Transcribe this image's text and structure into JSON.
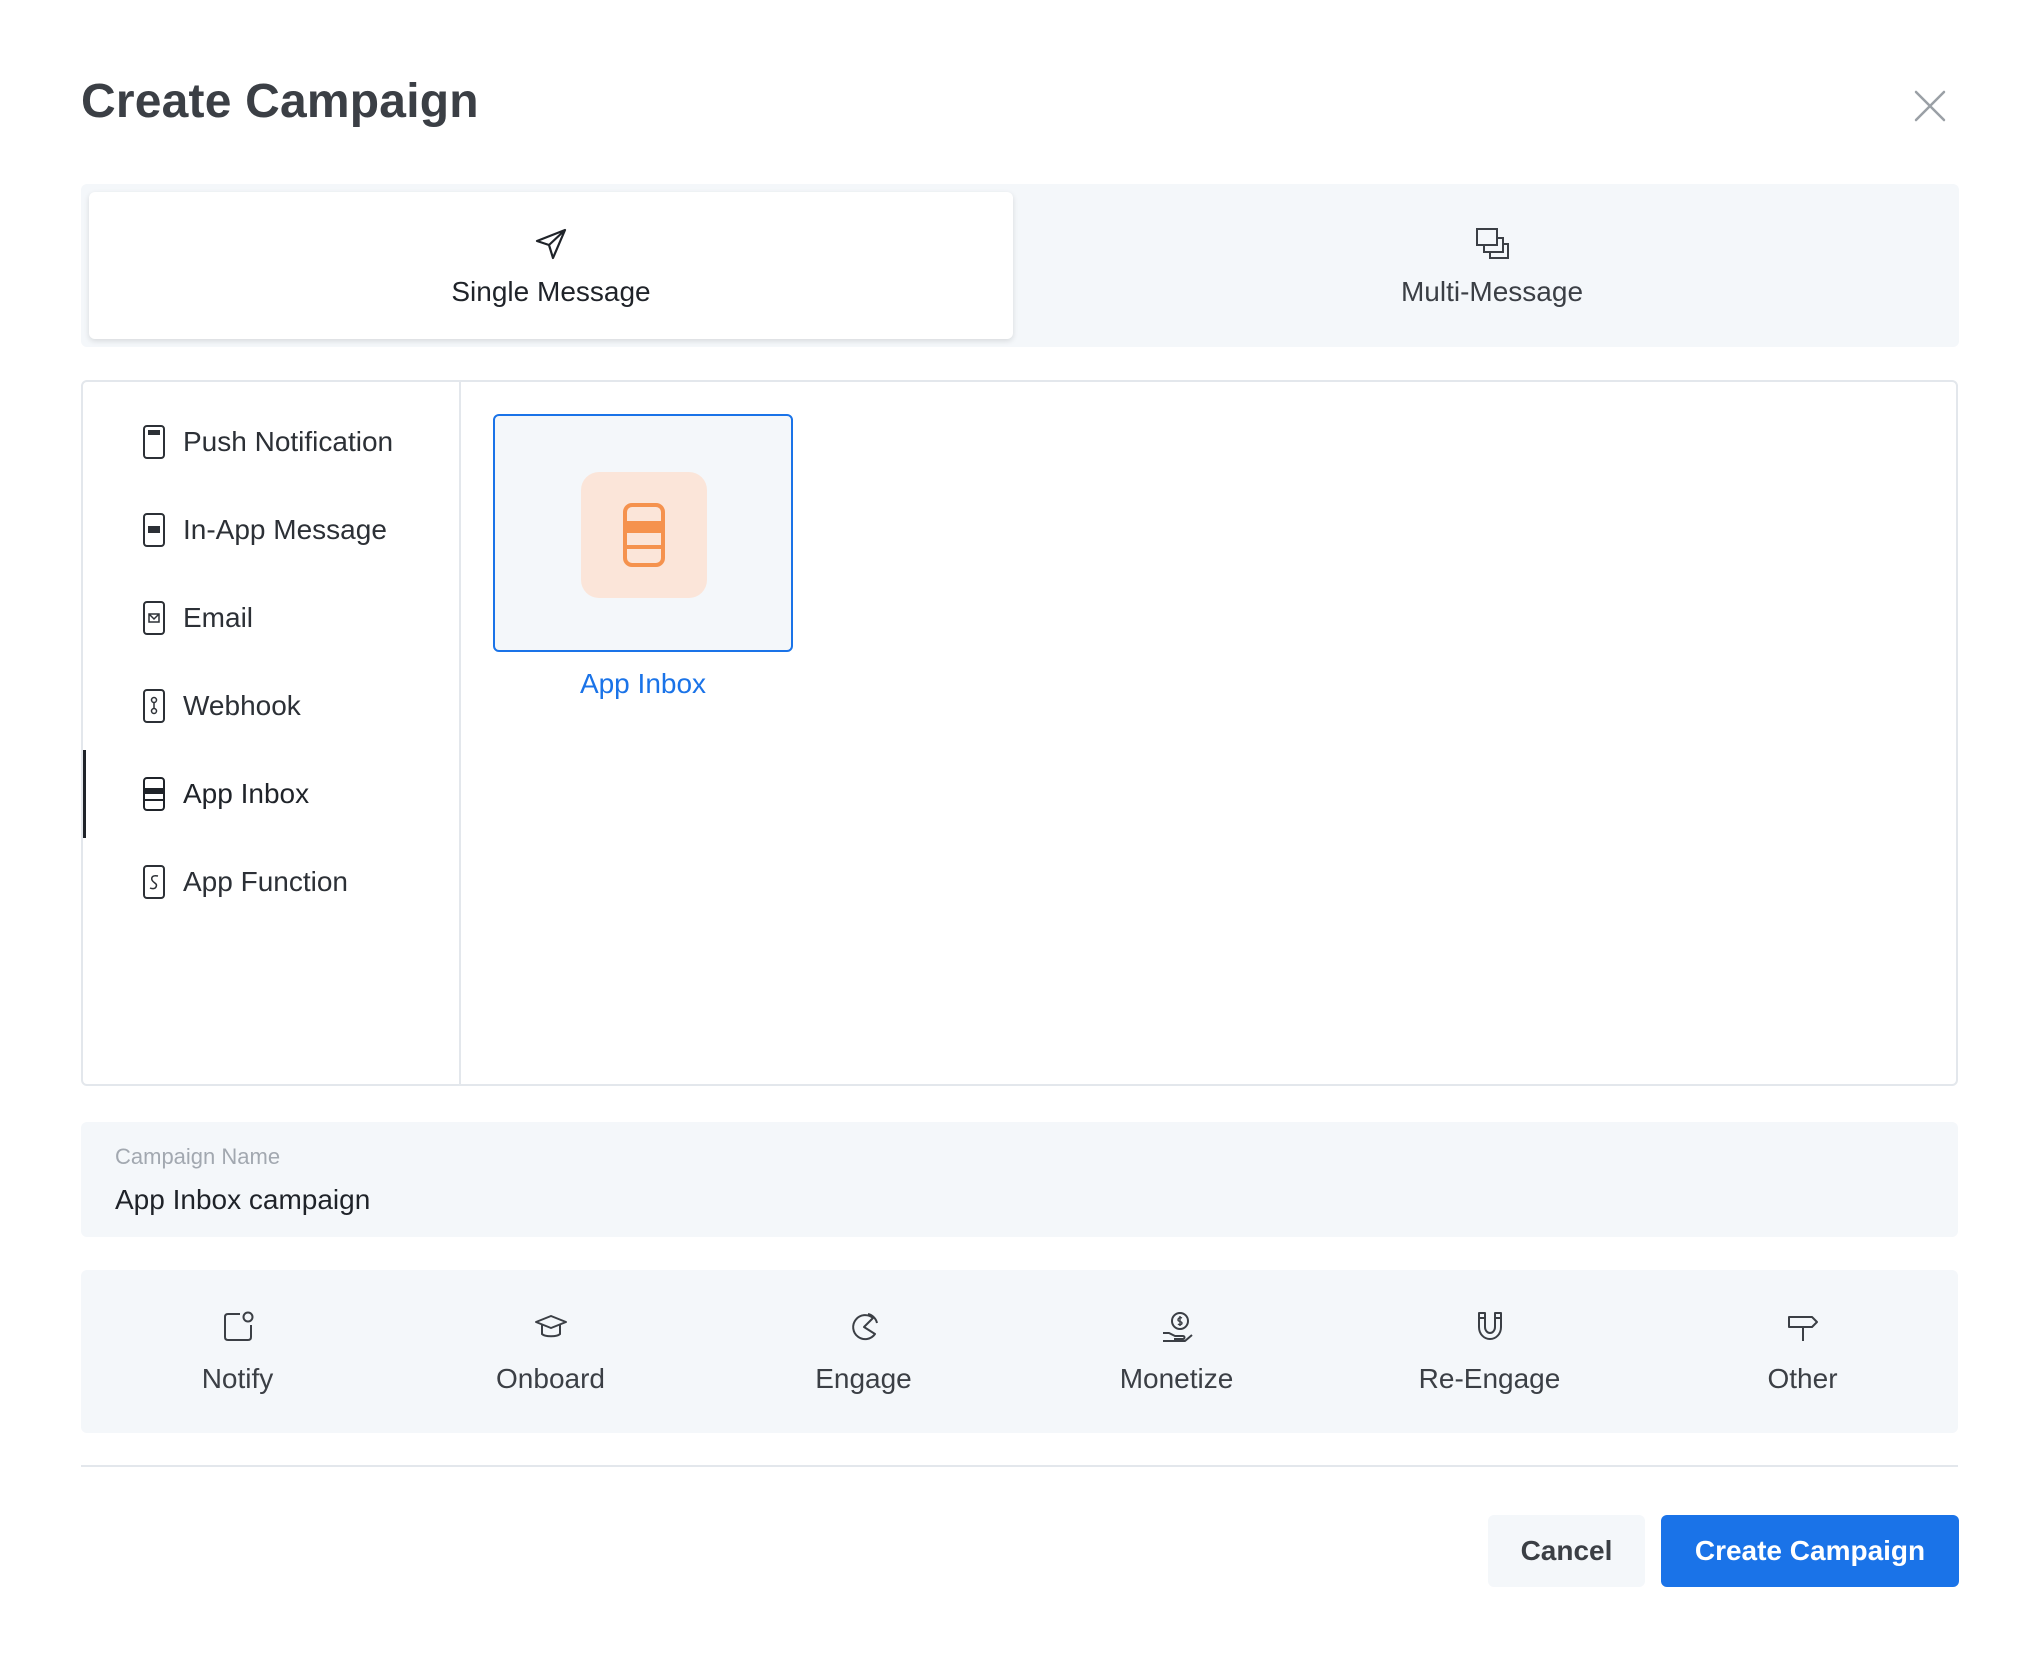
{
  "dialog": {
    "title": "Create Campaign",
    "close_icon": "close-icon"
  },
  "mode_tabs": [
    {
      "label": "Single Message",
      "icon": "paper-plane-icon",
      "selected": true
    },
    {
      "label": "Multi-Message",
      "icon": "stacked-squares-icon",
      "selected": false
    }
  ],
  "channels": [
    {
      "label": "Push Notification",
      "icon": "push-notification-icon",
      "selected": false
    },
    {
      "label": "In-App Message",
      "icon": "in-app-message-icon",
      "selected": false
    },
    {
      "label": "Email",
      "icon": "email-icon",
      "selected": false
    },
    {
      "label": "Webhook",
      "icon": "webhook-icon",
      "selected": false
    },
    {
      "label": "App Inbox",
      "icon": "app-inbox-icon",
      "selected": true
    },
    {
      "label": "App Function",
      "icon": "app-function-icon",
      "selected": false
    }
  ],
  "templates": [
    {
      "label": "App Inbox",
      "icon": "app-inbox-icon",
      "selected": true
    }
  ],
  "campaign_name": {
    "label": "Campaign Name",
    "value": "App Inbox campaign"
  },
  "goals": [
    {
      "label": "Notify",
      "icon": "notify-icon"
    },
    {
      "label": "Onboard",
      "icon": "graduation-cap-icon"
    },
    {
      "label": "Engage",
      "icon": "pie-icon"
    },
    {
      "label": "Monetize",
      "icon": "money-hand-icon"
    },
    {
      "label": "Re-Engage",
      "icon": "magnet-icon"
    },
    {
      "label": "Other",
      "icon": "signpost-icon"
    }
  ],
  "footer": {
    "cancel_label": "Cancel",
    "create_label": "Create Campaign"
  },
  "colors": {
    "accent": "#1a73e8",
    "tile_bg": "#fbe5d9",
    "tile_icon": "#f5924e",
    "panel_bg": "#f4f7fa"
  }
}
